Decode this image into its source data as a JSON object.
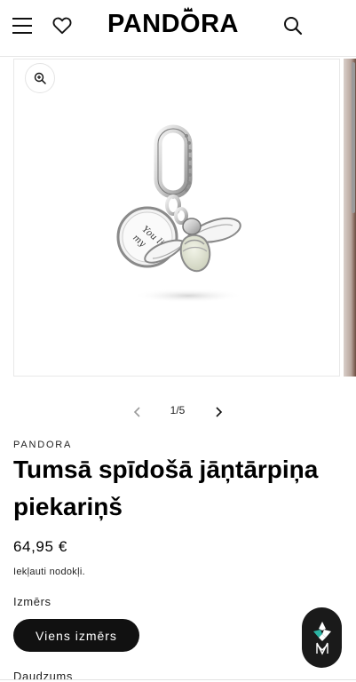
{
  "header": {
    "logo_text": "PANDORA",
    "menu_icon": "hamburger-menu-icon",
    "wishlist_icon": "heart-icon",
    "search_icon": "search-icon"
  },
  "gallery": {
    "zoom_icon": "zoom-in-icon",
    "charm_engraving": "You light my",
    "pager": {
      "current": 1,
      "total": 5,
      "label": "1/5"
    }
  },
  "product": {
    "brand": "PANDORA",
    "title": "Tumsā spīdošā jāņtārpiņa piekariņš",
    "price": "64,95 €",
    "tax_note": "Iekļauti nodokļi.",
    "size_label": "Izmērs",
    "size_option": "Viens izmērs",
    "quantity_label": "Daudzums"
  },
  "assistant": {
    "icon": "assistant-logo-icon"
  }
}
